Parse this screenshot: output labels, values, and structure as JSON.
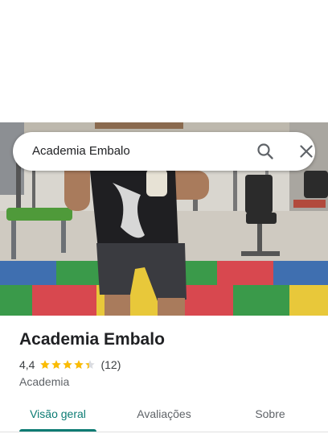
{
  "search": {
    "query": "Academia Embalo",
    "search_icon": "search-icon",
    "close_icon": "close-icon"
  },
  "place": {
    "title": "Academia Embalo",
    "rating": "4,4",
    "stars": 4.4,
    "max_stars": 5,
    "review_count": "(12)",
    "category": "Academia"
  },
  "tabs": [
    {
      "label": "Visão geral",
      "selected": true
    },
    {
      "label": "Avaliações",
      "selected": false
    },
    {
      "label": "Sobre",
      "selected": false
    }
  ],
  "colors": {
    "accent": "#0b7b73",
    "star": "#fbbc04",
    "star_empty": "#dadce0"
  }
}
